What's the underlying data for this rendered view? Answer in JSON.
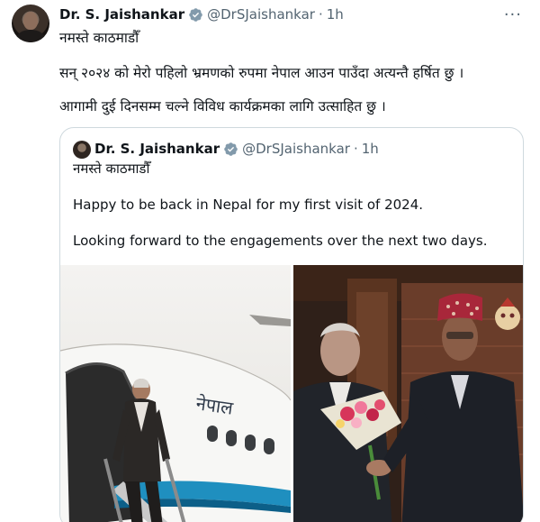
{
  "tweet": {
    "author_name": "Dr. S. Jaishankar",
    "handle": "@DrSJaishankar",
    "separator": "·",
    "time": "1h",
    "more_label": "···",
    "lines": [
      "नमस्ते काठमाडौँ",
      "सन् २०२४ को मेरो पहिलो भ्रमणको रुपमा नेपाल आउन पाउँदा अत्यन्तै हर्षित छु ।",
      "आगामी दुई दिनसम्म चल्ने विविध कार्यक्रमका लागि उत्साहित छु ।"
    ]
  },
  "quoted": {
    "author_name": "Dr. S. Jaishankar",
    "handle": "@DrSJaishankar",
    "separator": "·",
    "time": "1h",
    "lines": [
      "नमस्ते काठमाडौँ",
      "Happy to be back in Nepal for my first visit of 2024.",
      "Looking forward to the engagements over the next two days."
    ],
    "photos": [
      {
        "icon": "photo-aircraft-arrival"
      },
      {
        "icon": "photo-flower-bouquet-welcome"
      }
    ]
  },
  "colors": {
    "text": "#0f1419",
    "secondary": "#536471",
    "verified": "#829aab",
    "border": "#cfd9de"
  }
}
